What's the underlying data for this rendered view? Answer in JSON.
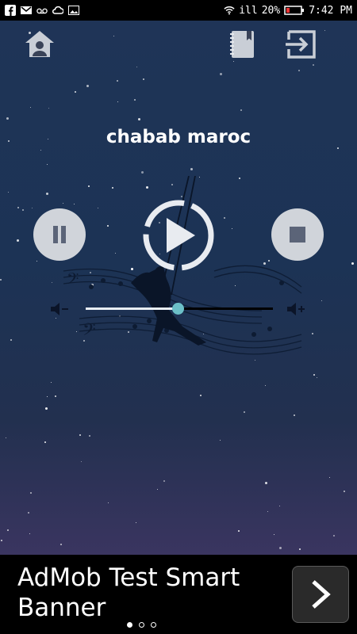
{
  "status_bar": {
    "signal": "ill",
    "battery_percent": "20",
    "battery_symbol": "%",
    "time": "7:42 PM",
    "notification_icons": [
      "facebook-icon",
      "gmail-icon",
      "voicemail-icon",
      "cloud-icon",
      "image-icon"
    ]
  },
  "player": {
    "station_title": "chabab maroc",
    "volume_level": 0.49
  },
  "colors": {
    "background_top": "#1f3457",
    "background_bottom": "#3a3560",
    "button_fill": "#d0d4da",
    "icon_fill": "#5b6478",
    "thumb": "#6cc0c8"
  },
  "ad_banner": {
    "text": "AdMob Test Smart Banner",
    "arrow_icon": "chevron-right-icon",
    "page_dots": 3,
    "active_dot": 0
  }
}
